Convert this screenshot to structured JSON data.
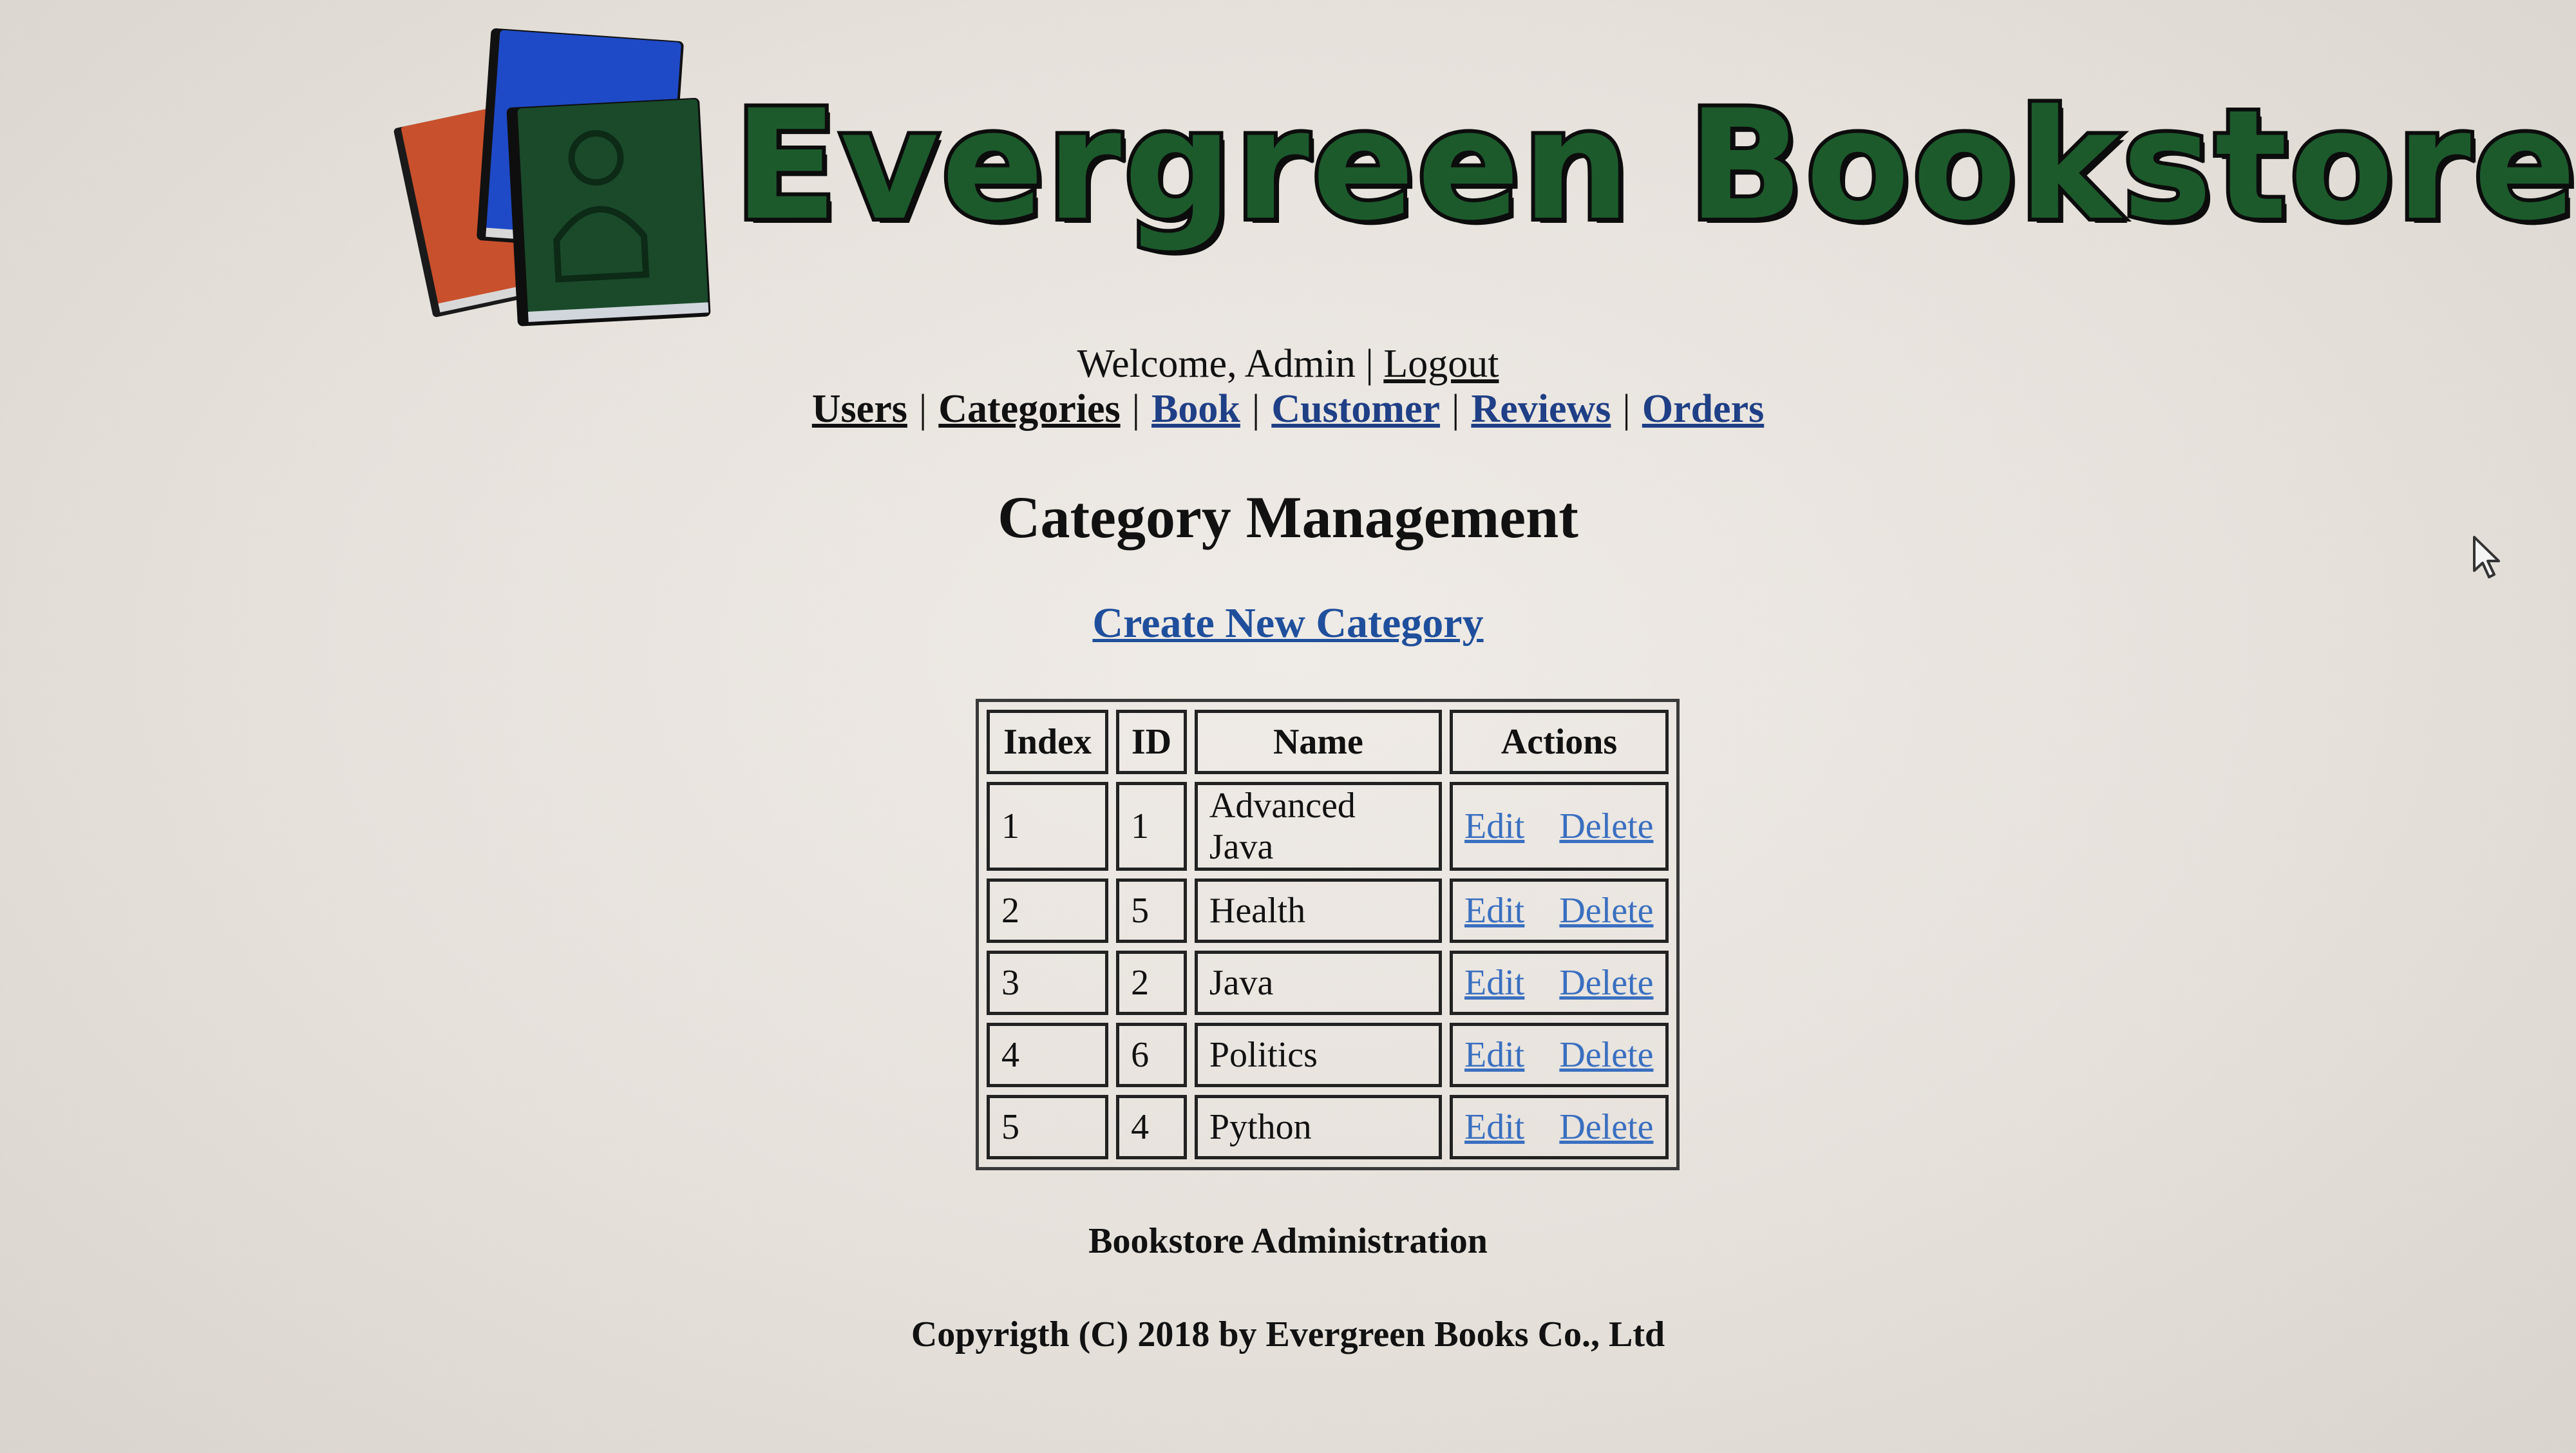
{
  "header": {
    "logo_text": "Evergreen Bookstore",
    "logo_icon": "books-logo-icon"
  },
  "welcome": {
    "text": "Welcome, Admin",
    "separator": "|",
    "logout_label": "Logout"
  },
  "nav": {
    "items": [
      {
        "label": "Users"
      },
      {
        "label": "Categories"
      },
      {
        "label": "Book"
      },
      {
        "label": "Customer"
      },
      {
        "label": "Reviews"
      },
      {
        "label": "Orders"
      }
    ],
    "separator": "|"
  },
  "main": {
    "title": "Category Management",
    "create_link": "Create New Category",
    "table": {
      "headers": [
        "Index",
        "ID",
        "Name",
        "Actions"
      ],
      "rows": [
        {
          "index": "1",
          "id": "1",
          "name": "Advanced Java",
          "edit": "Edit",
          "delete": "Delete"
        },
        {
          "index": "2",
          "id": "5",
          "name": "Health",
          "edit": "Edit",
          "delete": "Delete"
        },
        {
          "index": "3",
          "id": "2",
          "name": "Java",
          "edit": "Edit",
          "delete": "Delete"
        },
        {
          "index": "4",
          "id": "6",
          "name": "Politics",
          "edit": "Edit",
          "delete": "Delete"
        },
        {
          "index": "5",
          "id": "4",
          "name": "Python",
          "edit": "Edit",
          "delete": "Delete"
        }
      ]
    }
  },
  "footer": {
    "admin": "Bookstore Administration",
    "copyright": "Copyrigth (C) 2018 by Evergreen Books Co., Ltd"
  },
  "colors": {
    "background": "#e6e1db",
    "link_blue": "#1f4f9c",
    "action_link": "#3a6fc0",
    "logo_green": "#1c5a2c"
  }
}
